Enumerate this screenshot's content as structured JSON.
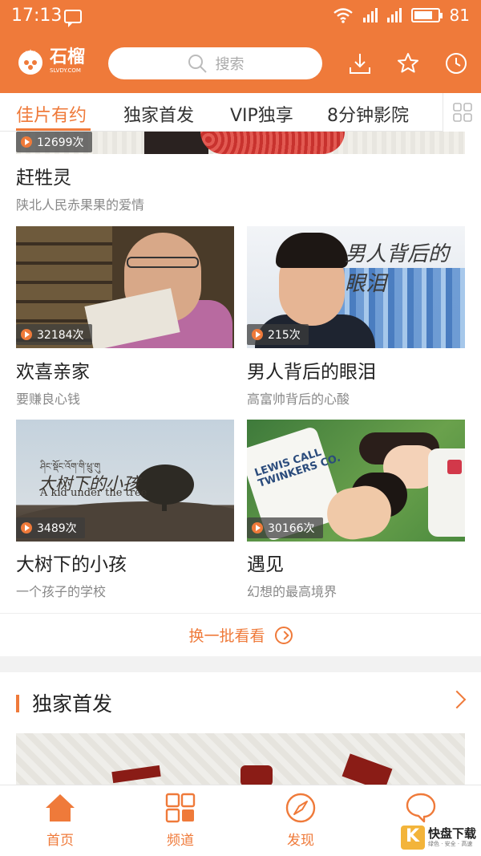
{
  "status_bar": {
    "time": "17:13",
    "battery": "81",
    "battery_level": 0.81,
    "network": "4G"
  },
  "header": {
    "logo_text": "石榴",
    "logo_sub": "SLVDY.COM",
    "search_placeholder": "搜索"
  },
  "tabs": [
    "佳片有约",
    "独家首发",
    "VIP独享",
    "8分钟影院"
  ],
  "active_tab_index": 0,
  "featured": {
    "views": "12699次",
    "title": "赶牲灵",
    "subtitle": "陕北人民赤果果的爱情"
  },
  "cards": [
    {
      "views": "32184次",
      "title": "欢喜亲家",
      "subtitle": "要赚良心钱"
    },
    {
      "views": "215次",
      "title": "男人背后的眼泪",
      "subtitle": "高富帅背后的心酸",
      "poster_text": "男人背后的眼泪"
    },
    {
      "views": "3489次",
      "title": "大树下的小孩",
      "subtitle": "一个孩子的学校",
      "poster_text_cn": "大树下的小孩",
      "poster_text_en": "A kid under the tree"
    },
    {
      "views": "30166次",
      "title": "遇见",
      "subtitle": "幻想的最高境界"
    }
  ],
  "refresh_label": "换一批看看",
  "section": {
    "title": "独家首发"
  },
  "bottom_nav": [
    {
      "label": "首页",
      "icon": "home-icon"
    },
    {
      "label": "频道",
      "icon": "grid-icon"
    },
    {
      "label": "发现",
      "icon": "compass-icon"
    },
    {
      "label": "",
      "icon": "chat-icon"
    }
  ],
  "watermark": {
    "text": "快盘下载",
    "sub": "绿色 · 安全 · 高速"
  },
  "colors": {
    "accent": "#ef7a3a"
  }
}
